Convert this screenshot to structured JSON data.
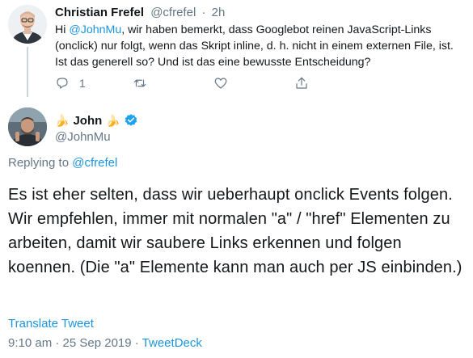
{
  "parent_tweet": {
    "author_name": "Christian Frefel",
    "handle": "@cfrefel",
    "separator": "·",
    "time": "2h",
    "text_before_mention": "Hi ",
    "mention": "@JohnMu",
    "text_after_mention": ", wir haben bemerkt, dass Googlebot reinen JavaScript-Links (onclick) nur folgt, wenn das Skript inline, d. h. nicht in einem externen File, ist. Ist das generell so? Und ist das eine bewusste Entscheidung?",
    "reply_count": "1",
    "icons": [
      "reply-icon",
      "retweet-icon",
      "like-icon",
      "share-icon"
    ]
  },
  "main_tweet": {
    "emoji_left": "🍌",
    "author_name": "John",
    "emoji_right": "🍌",
    "verified_icon": "verified-badge-icon",
    "handle": "@JohnMu",
    "replying_prefix": "Replying to ",
    "replying_to": "@cfrefel",
    "text": "Es ist eher selten, dass wir ueberhaupt onclick Events folgen. Wir empfehlen, immer mit normalen \"a\" / \"href\" Elementen zu arbeiten, damit wir saubere Links erkennen und folgen koennen. (Die \"a\" Elemente kann man auch per JS einbinden.)",
    "translate_label": "Translate Tweet",
    "timestamp": "9:10 am · 25 Sep 2019",
    "separator": " · ",
    "source": "TweetDeck"
  },
  "colors": {
    "link": "#1b95e0",
    "secondary_text": "#657786",
    "primary_text": "#14171a",
    "thread_line": "#ccd6dd"
  }
}
